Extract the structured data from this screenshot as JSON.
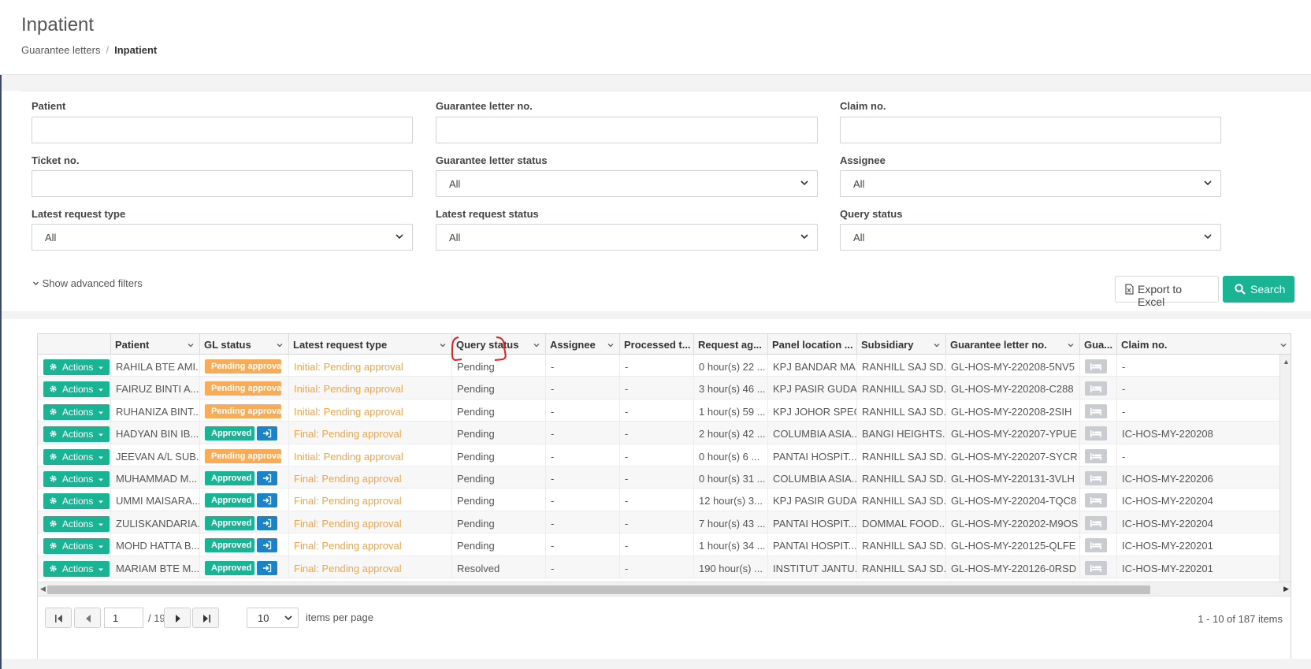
{
  "page": {
    "title": "Inpatient",
    "breadcrumb": [
      "Guarantee letters",
      "Inpatient"
    ]
  },
  "filters": {
    "patient_label": "Patient",
    "gl_no_label": "Guarantee letter no.",
    "claim_no_label": "Claim no.",
    "ticket_no_label": "Ticket no.",
    "gl_status_label": "Guarantee letter status",
    "gl_status_value": "All",
    "assignee_label": "Assignee",
    "assignee_value": "All",
    "req_type_label": "Latest request type",
    "req_type_value": "All",
    "req_status_label": "Latest request status",
    "req_status_value": "All",
    "query_status_label": "Query status",
    "query_status_value": "All",
    "advanced_label": "Show advanced filters",
    "export_label": "Export to Excel",
    "search_label": "Search"
  },
  "table": {
    "headers": [
      "Patient",
      "GL status",
      "Latest request type",
      "Query status",
      "Assignee",
      "Processed t...",
      "Request ag...",
      "Panel location ...",
      "Subsidiary",
      "Guarantee letter no.",
      "Gua...",
      "Claim no."
    ],
    "action_label": "Actions",
    "rows": [
      {
        "patient": "RAHILA BTE AMI...",
        "gl_status": "Pending approval",
        "gl_type": "pending",
        "req_type": "Initial: Pending approval",
        "query": "Pending",
        "assignee": "-",
        "processed": "-",
        "age": "0 hour(s) 22 ...",
        "panel": "KPJ BANDAR MA...",
        "subsidiary": "RANHILL SAJ SD...",
        "gl_no": "GL-HOS-MY-220208-5NV5",
        "claim": "-"
      },
      {
        "patient": "FAIRUZ BINTI A...",
        "gl_status": "Pending approval",
        "gl_type": "pending",
        "req_type": "Initial: Pending approval",
        "query": "Pending",
        "assignee": "-",
        "processed": "-",
        "age": "3 hour(s) 46 ...",
        "panel": "KPJ PASIR GUDA...",
        "subsidiary": "RANHILL SAJ SD...",
        "gl_no": "GL-HOS-MY-220208-C288",
        "claim": "-"
      },
      {
        "patient": "RUHANIZA BINT...",
        "gl_status": "Pending approval",
        "gl_type": "pending",
        "req_type": "Initial: Pending approval",
        "query": "Pending",
        "assignee": "-",
        "processed": "-",
        "age": "1 hour(s) 59 ...",
        "panel": "KPJ JOHOR SPEC...",
        "subsidiary": "RANHILL SAJ SD...",
        "gl_no": "GL-HOS-MY-220208-2SIH",
        "claim": "-"
      },
      {
        "patient": "HADYAN BIN IB...",
        "gl_status": "Approved",
        "gl_type": "approved",
        "req_type": "Final: Pending approval",
        "query": "Pending",
        "assignee": "-",
        "processed": "-",
        "age": "2 hour(s) 42 ...",
        "panel": "COLUMBIA ASIA...",
        "subsidiary": "BANGI HEIGHTS...",
        "gl_no": "GL-HOS-MY-220207-YPUE",
        "claim": "IC-HOS-MY-220208"
      },
      {
        "patient": "JEEVAN A/L SUB...",
        "gl_status": "Pending approval",
        "gl_type": "pending",
        "req_type": "Initial: Pending approval",
        "query": "Pending",
        "assignee": "-",
        "processed": "-",
        "age": "0 hour(s) 6 ...",
        "panel": "PANTAI HOSPIT...",
        "subsidiary": "RANHILL SAJ SD...",
        "gl_no": "GL-HOS-MY-220207-SYCR",
        "claim": "-"
      },
      {
        "patient": "MUHAMMAD M...",
        "gl_status": "Approved",
        "gl_type": "approved",
        "req_type": "Final: Pending approval",
        "query": "Pending",
        "assignee": "-",
        "processed": "-",
        "age": "0 hour(s) 31 ...",
        "panel": "COLUMBIA ASIA...",
        "subsidiary": "RANHILL SAJ SD...",
        "gl_no": "GL-HOS-MY-220131-3VLH",
        "claim": "IC-HOS-MY-220206"
      },
      {
        "patient": "UMMI MAISARA...",
        "gl_status": "Approved",
        "gl_type": "approved",
        "req_type": "Final: Pending approval",
        "query": "Pending",
        "assignee": "-",
        "processed": "-",
        "age": "12 hour(s) 3...",
        "panel": "KPJ PASIR GUDA...",
        "subsidiary": "RANHILL SAJ SD...",
        "gl_no": "GL-HOS-MY-220204-TQC8",
        "claim": "IC-HOS-MY-220204"
      },
      {
        "patient": "ZULISKANDARIA...",
        "gl_status": "Approved",
        "gl_type": "approved",
        "req_type": "Final: Pending approval",
        "query": "Pending",
        "assignee": "-",
        "processed": "-",
        "age": "7 hour(s) 43 ...",
        "panel": "PANTAI HOSPIT...",
        "subsidiary": "DOMMAL FOOD...",
        "gl_no": "GL-HOS-MY-220202-M9OS",
        "claim": "IC-HOS-MY-220204"
      },
      {
        "patient": "MOHD HATTA B...",
        "gl_status": "Approved",
        "gl_type": "approved",
        "req_type": "Final: Pending approval",
        "query": "Pending",
        "assignee": "-",
        "processed": "-",
        "age": "1 hour(s) 34 ...",
        "panel": "PANTAI HOSPIT...",
        "subsidiary": "RANHILL SAJ SD...",
        "gl_no": "GL-HOS-MY-220125-QLFE",
        "claim": "IC-HOS-MY-220201"
      },
      {
        "patient": "MARIAM BTE M...",
        "gl_status": "Approved",
        "gl_type": "approved",
        "req_type": "Final: Pending approval",
        "query": "Resolved",
        "assignee": "-",
        "processed": "-",
        "age": "190 hour(s) ...",
        "panel": "INSTITUT JANTU...",
        "subsidiary": "RANHILL SAJ SD...",
        "gl_no": "GL-HOS-MY-220126-0RSD",
        "claim": "IC-HOS-MY-220201"
      }
    ]
  },
  "pager": {
    "page": "1",
    "total_pages": "/ 19",
    "page_size": "10",
    "page_size_label": "items per page",
    "info": "1 - 10 of 187 items"
  },
  "colors": {
    "primary": "#1ab394",
    "warning": "#f8ac59",
    "info": "#1c84c6",
    "link_orange": "#f0a54a",
    "annotation": "#e02020"
  },
  "icons": [
    "gear-icon",
    "caret-down-icon",
    "login-icon",
    "bed-icon",
    "search-icon",
    "excel-file-icon",
    "chevron-down-icon",
    "first-page-icon",
    "prev-page-icon",
    "next-page-icon",
    "last-page-icon"
  ]
}
